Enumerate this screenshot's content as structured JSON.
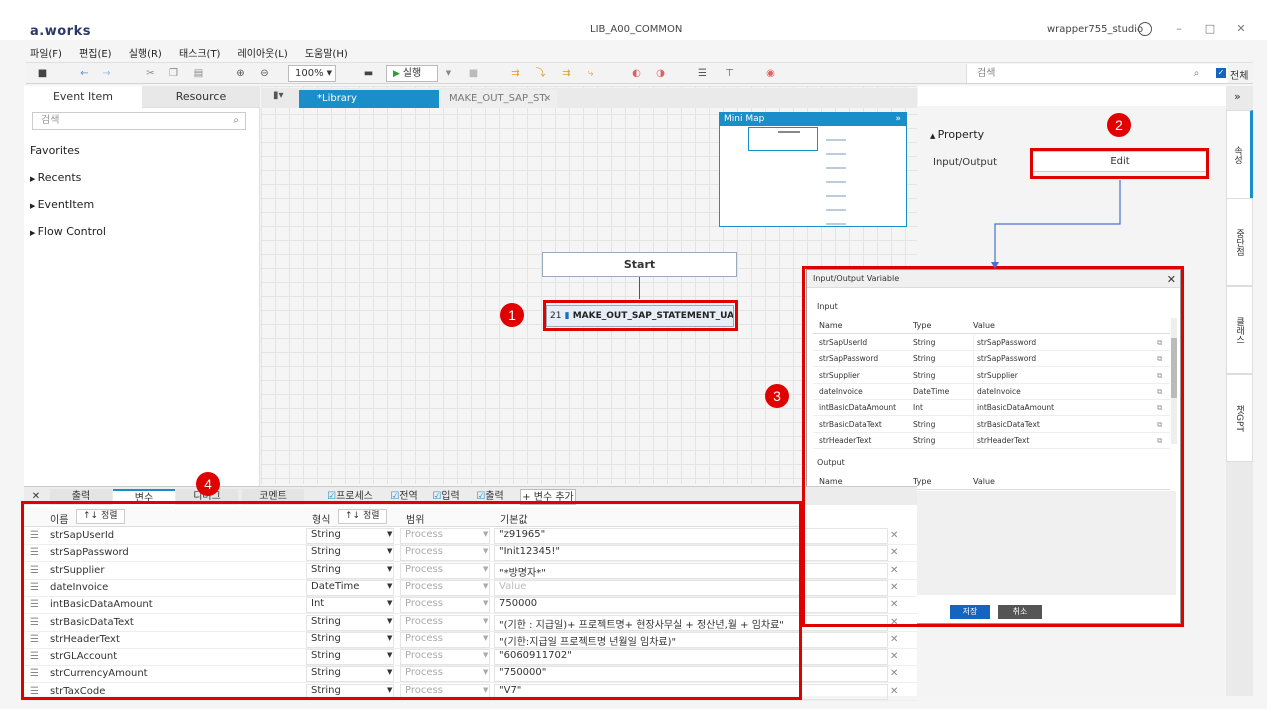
{
  "app": {
    "logo": "a.works",
    "window_title": "LIB_A00_COMMON",
    "user": "wrapper755_studio",
    "menu": [
      "파일(F)",
      "편집(E)",
      "실행(R)",
      "태스크(T)",
      "레이아웃(L)",
      "도움말(H)"
    ]
  },
  "toolbar": {
    "zoom": "100%",
    "run_label": "실행",
    "search_placeholder": "검색",
    "all_label": "전체"
  },
  "left_panel": {
    "tabs": [
      "Event Item",
      "Resource"
    ],
    "search_placeholder": "검색",
    "favorites": "Favorites",
    "tree": [
      "Recents",
      "EventItem",
      "Flow Control"
    ]
  },
  "editor": {
    "tabs": [
      "*Library",
      "MAKE_OUT_SAP_ST."
    ],
    "minimap_title": "Mini Map",
    "start_node": "Start",
    "process_node_id": "21",
    "process_node": "MAKE_OUT_SAP_STATEMENT_UAH"
  },
  "property": {
    "header": "Property",
    "io_label": "Input/Output",
    "edit_label": "Edit"
  },
  "vertical_tabs": [
    "속성",
    "중단점",
    "클래스",
    "챗GPT"
  ],
  "dialog": {
    "title": "Input/Output Variable",
    "input_label": "Input",
    "output_label": "Output",
    "columns": [
      "Name",
      "Type",
      "Value"
    ],
    "inputs": [
      {
        "name": "strSapUserId",
        "type": "String",
        "value": "strSapPassword"
      },
      {
        "name": "strSapPassword",
        "type": "String",
        "value": "strSapPassword"
      },
      {
        "name": "strSupplier",
        "type": "String",
        "value": "strSupplier"
      },
      {
        "name": "dateInvoice",
        "type": "DateTime",
        "value": "dateInvoice"
      },
      {
        "name": "intBasicDataAmount",
        "type": "Int",
        "value": "intBasicDataAmount"
      },
      {
        "name": "strBasicDataText",
        "type": "String",
        "value": "strBasicDataText"
      },
      {
        "name": "strHeaderText",
        "type": "String",
        "value": "strHeaderText"
      }
    ],
    "save_label": "저장",
    "cancel_label": "취소"
  },
  "bottom": {
    "tabs": [
      "출력",
      "변수",
      "디버그",
      "코멘트"
    ],
    "checks": [
      "프로세스",
      "전역",
      "입력",
      "출력"
    ],
    "add_var": "+ 변수 추가",
    "headers": {
      "name": "이름",
      "sort": "↑↓ 정렬",
      "type": "형식",
      "scope": "범위",
      "default": "기본값"
    },
    "rows": [
      {
        "name": "strSapUserId",
        "type": "String",
        "scope": "Process",
        "value": "\"z91965\""
      },
      {
        "name": "strSapPassword",
        "type": "String",
        "scope": "Process",
        "value": "\"Init12345!\""
      },
      {
        "name": "strSupplier",
        "type": "String",
        "scope": "Process",
        "value": "\"*방명자*\""
      },
      {
        "name": "dateInvoice",
        "type": "DateTime",
        "scope": "Process",
        "value": "Value"
      },
      {
        "name": "intBasicDataAmount",
        "type": "Int",
        "scope": "Process",
        "value": "750000"
      },
      {
        "name": "strBasicDataText",
        "type": "String",
        "scope": "Process",
        "value": "\"(기한 : 지급일)+ 프로젝트명+ 현장사무실 + 정산년,월 + 임차료\""
      },
      {
        "name": "strHeaderText",
        "type": "String",
        "scope": "Process",
        "value": "\"(기한:지급일 프로젝트명 년월일 임차료)\""
      },
      {
        "name": "strGLAccount",
        "type": "String",
        "scope": "Process",
        "value": "\"6060911702\""
      },
      {
        "name": "strCurrencyAmount",
        "type": "String",
        "scope": "Process",
        "value": "\"750000\""
      },
      {
        "name": "strTaxCode",
        "type": "String",
        "scope": "Process",
        "value": "\"V7\""
      }
    ]
  },
  "annotations": [
    "1",
    "2",
    "3",
    "4"
  ],
  "colors": {
    "accent": "#1a8ec8",
    "annotation": "#e00000",
    "save": "#1565c0"
  }
}
